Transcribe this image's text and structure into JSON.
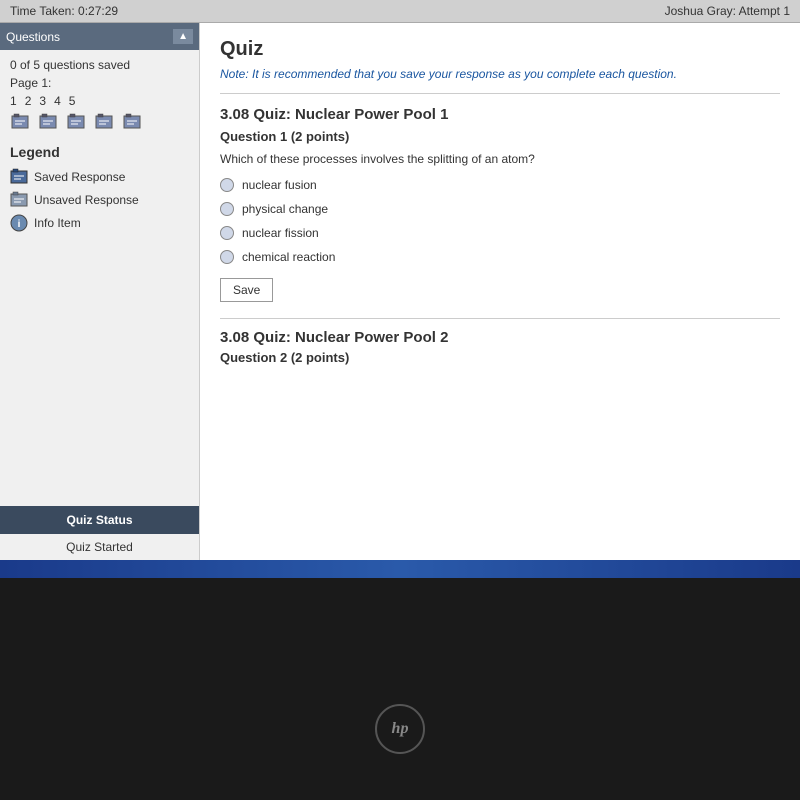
{
  "topbar": {
    "time_taken_label": "Time Taken:",
    "time_taken_value": "0:27:29",
    "student": "Joshua Gray: Attempt 1"
  },
  "sidebar": {
    "questions_header": "Questions",
    "saved_count": "0 of 5 questions saved",
    "page_label": "Page 1:",
    "question_numbers": [
      "1",
      "2",
      "3",
      "4",
      "5"
    ],
    "legend_title": "Legend",
    "legend_items": [
      {
        "label": "Saved Response",
        "type": "saved"
      },
      {
        "label": "Unsaved Response",
        "type": "unsaved"
      },
      {
        "label": "Info Item",
        "type": "info"
      }
    ],
    "quiz_status_label": "Quiz Status",
    "quiz_started_label": "Quiz Started"
  },
  "quiz": {
    "title": "Quiz",
    "note": "Note: It is recommended that you save your response as you complete each question.",
    "sections": [
      {
        "section_title": "3.08 Quiz: Nuclear Power Pool 1",
        "question_label": "Question 1",
        "points": "(2 points)",
        "question_text": "Which of these processes involves the splitting of an atom?",
        "options": [
          "nuclear fusion",
          "physical change",
          "nuclear fission",
          "chemical reaction"
        ],
        "save_button": "Save"
      },
      {
        "section_title": "3.08 Quiz: Nuclear Power Pool 2",
        "question_label": "Question 2",
        "points": "(2 points)"
      }
    ]
  },
  "monitor": {
    "hp_label": "hp"
  }
}
